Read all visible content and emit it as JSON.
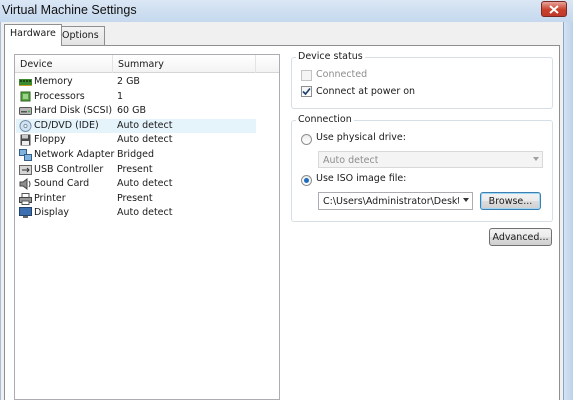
{
  "window": {
    "title": "Virtual Machine Settings"
  },
  "tabs": [
    {
      "label": "Hardware",
      "active": true
    },
    {
      "label": "Options",
      "active": false
    }
  ],
  "device_list": {
    "columns": [
      "Device",
      "Summary"
    ],
    "rows": [
      {
        "device": "Memory",
        "summary": "2 GB",
        "icon": "memory-icon"
      },
      {
        "device": "Processors",
        "summary": "1",
        "icon": "processor-icon"
      },
      {
        "device": "Hard Disk (SCSI)",
        "summary": "60 GB",
        "icon": "hard-disk-icon"
      },
      {
        "device": "CD/DVD (IDE)",
        "summary": "Auto detect",
        "icon": "cd-dvd-icon",
        "selected": true
      },
      {
        "device": "Floppy",
        "summary": "Auto detect",
        "icon": "floppy-icon"
      },
      {
        "device": "Network Adapter",
        "summary": "Bridged",
        "icon": "network-adapter-icon"
      },
      {
        "device": "USB Controller",
        "summary": "Present",
        "icon": "usb-icon"
      },
      {
        "device": "Sound Card",
        "summary": "Auto detect",
        "icon": "sound-card-icon"
      },
      {
        "device": "Printer",
        "summary": "Present",
        "icon": "printer-icon"
      },
      {
        "device": "Display",
        "summary": "Auto detect",
        "icon": "display-icon"
      }
    ]
  },
  "device_status": {
    "title": "Device status",
    "connected_label": "Connected",
    "connected_checked": false,
    "connected_enabled": false,
    "connect_at_power_on_label": "Connect at power on",
    "connect_at_power_on_checked": true
  },
  "connection": {
    "title": "Connection",
    "physical_drive_label": "Use physical drive:",
    "physical_drive_selected": false,
    "physical_drive_value": "Auto detect",
    "iso_label": "Use ISO image file:",
    "iso_selected": true,
    "iso_path": "C:\\Users\\Administrator\\Desktop",
    "browse_label": "Browse...",
    "advanced_label": "Advanced..."
  },
  "colors": {
    "title_bar": "#c5d8ee",
    "close_button": "#c9402b",
    "selection": "#e5f3fb",
    "radio_dot": "#1e6dbd"
  }
}
